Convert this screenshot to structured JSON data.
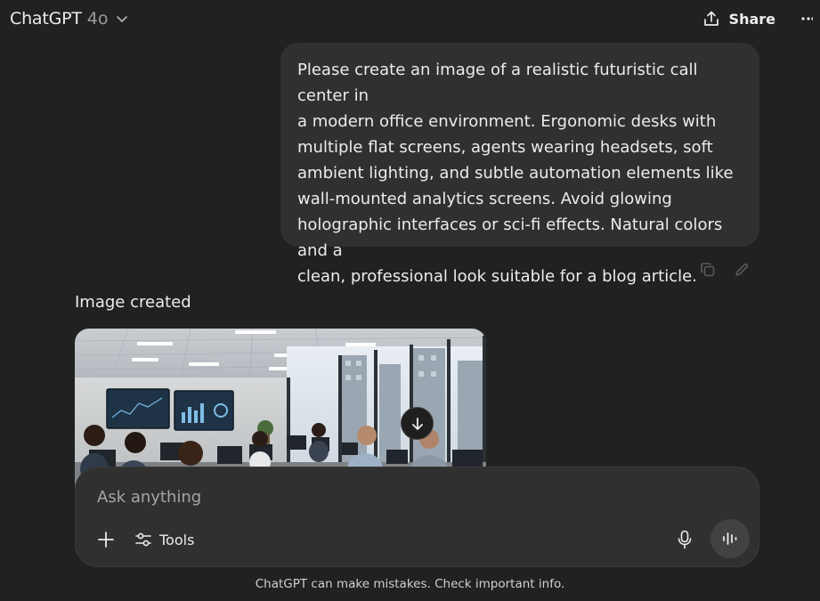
{
  "header": {
    "app_name": "ChatGPT",
    "model": "4o",
    "share_label": "Share"
  },
  "conversation": {
    "user_message": {
      "lines": [
        "Please create an image of a realistic futuristic call center in",
        "a modern office environment. Ergonomic desks with",
        "multiple flat screens, agents wearing headsets, soft",
        "ambient lighting, and subtle automation elements like",
        "wall-mounted analytics screens. Avoid glowing",
        "holographic interfaces or sci-fi effects. Natural colors and a",
        "clean, professional look suitable for a blog article."
      ]
    },
    "assistant": {
      "status": "Image created"
    }
  },
  "composer": {
    "placeholder": "Ask anything",
    "tools_label": "Tools"
  },
  "footer": {
    "disclaimer": "ChatGPT can make mistakes. Check important info."
  },
  "icons": {
    "model_dropdown": "chevron-down-icon",
    "share": "share-icon",
    "more": "more-horizontal-icon",
    "copy": "copy-icon",
    "edit": "pencil-icon",
    "scroll_down": "arrow-down-icon",
    "attach": "plus-icon",
    "tools": "sliders-icon",
    "dictate": "microphone-icon",
    "voice_mode": "waveform-icon"
  },
  "colors": {
    "background": "#212121",
    "bubble": "#303030",
    "text": "#ececec",
    "muted": "#9b9b9b"
  }
}
